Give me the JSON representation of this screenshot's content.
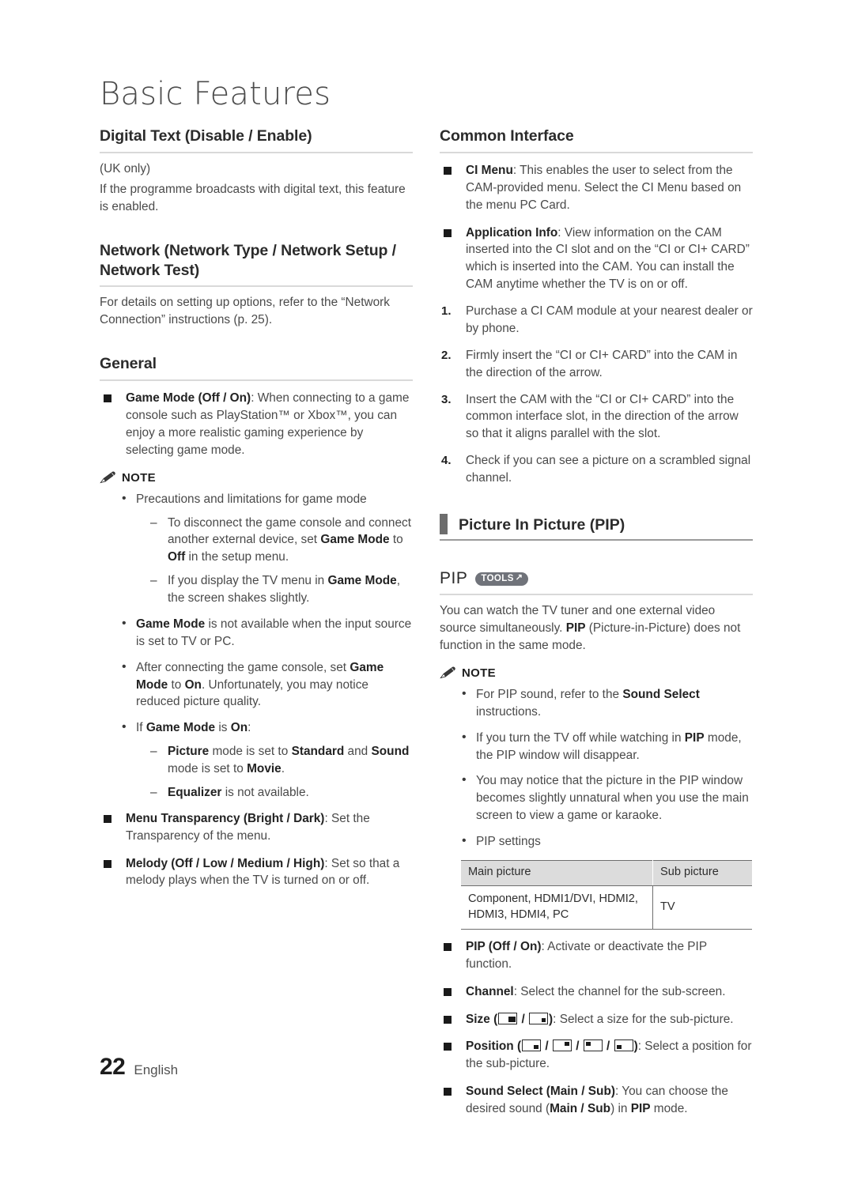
{
  "chapter": {
    "title": "Basic Features"
  },
  "footer": {
    "page_number": "22",
    "language": "English"
  },
  "left_column": {
    "digital_text": {
      "heading": "Digital Text (Disable / Enable)",
      "uk_only": "(UK only)",
      "body": "If the programme broadcasts with digital text, this feature is enabled."
    },
    "network": {
      "heading": "Network (Network Type / Network Setup / Network Test)",
      "body": "For details on setting up options, refer to the “Network Connection” instructions (p. 25)."
    },
    "general": {
      "heading": "General",
      "game_mode": {
        "term": "Game Mode (Off / On)",
        "text": ": When connecting to a game console such as PlayStation™ or Xbox™, you can enjoy a more realistic gaming experience by selecting game mode."
      },
      "note": {
        "label": "NOTE",
        "icon": "pencil-icon",
        "items": [
          {
            "text": "Precautions and limitations for game mode",
            "subitems": [
              "To disconnect the game console and connect another external device, set Game Mode to Off in the setup menu.",
              "If you display the TV menu in Game Mode, the screen shakes slightly."
            ]
          },
          {
            "text": "Game Mode is not available when the input source is set to TV or PC."
          },
          {
            "text": "After connecting the game console, set Game Mode to On. Unfortunately, you may notice reduced picture quality."
          },
          {
            "text": "If Game Mode is On:",
            "subitems": [
              "Picture mode is set to Standard and Sound mode is set to Movie.",
              "Equalizer is not available."
            ]
          }
        ]
      },
      "menu_transparency": {
        "term": "Menu Transparency (Bright / Dark)",
        "text": ": Set the Transparency of the menu."
      },
      "melody": {
        "term": "Melody (Off / Low / Medium / High)",
        "text": ": Set so that a melody plays when the TV is turned on or off."
      }
    }
  },
  "right_column": {
    "common_interface": {
      "heading": "Common Interface",
      "bullets": [
        {
          "term": "CI Menu",
          "text": ": This enables the user to select from the CAM-provided menu. Select the CI Menu based on the menu PC Card."
        },
        {
          "term": "Application Info",
          "text": ": View information on the CAM inserted into the CI slot and on the “CI or CI+ CARD” which is inserted into the CAM. You can install the CAM anytime whether the TV is on or off."
        }
      ],
      "steps": [
        {
          "num": "1.",
          "text": "Purchase a CI CAM module at your nearest dealer or by phone."
        },
        {
          "num": "2.",
          "text": "Firmly insert the “CI or CI+ CARD” into the CAM in the direction of the arrow."
        },
        {
          "num": "3.",
          "text": "Insert the CAM with the “CI or CI+ CARD” into the common interface slot, in the direction of the arrow so that it aligns parallel with the slot."
        },
        {
          "num": "4.",
          "text": "Check if you can see a picture on a scrambled signal channel."
        }
      ]
    },
    "pip_section": {
      "bar_heading": "Picture In Picture (PIP)",
      "pip_heading": "PIP",
      "tools_badge": {
        "label": "TOOLS",
        "icon": "tools-arrow-icon",
        "glyph": "↗"
      },
      "intro": "You can watch the TV tuner and one external video source simultaneously. PIP (Picture-in-Picture) does not function in the same mode.",
      "note": {
        "label": "NOTE",
        "icon": "pencil-icon",
        "items": [
          "For PIP sound, refer to the Sound Select instructions.",
          "If you turn the TV off while watching in PIP mode, the PIP window will disappear.",
          "You may notice that the picture in the PIP window becomes slightly unnatural when you use the main screen to view a game or karaoke.",
          "PIP settings"
        ]
      },
      "table": {
        "headers": [
          "Main picture",
          "Sub picture"
        ],
        "rows": [
          [
            "Component, HDMI1/DVI, HDMI2, HDMI3, HDMI4, PC",
            "TV"
          ]
        ]
      },
      "bullets": [
        {
          "term": "PIP (Off / On)",
          "text": ": Activate or deactivate the PIP function."
        },
        {
          "term": "Channel",
          "text": ": Select the channel for the sub-screen."
        },
        {
          "term": "Size",
          "text": ": Select a size for the sub-picture.",
          "icons": [
            "size-large-icon",
            "size-small-icon"
          ]
        },
        {
          "term": "Position",
          "text": ": Select a position for the sub-picture.",
          "icons": [
            "position-bottom-right-icon",
            "position-top-right-icon",
            "position-top-left-icon",
            "position-bottom-left-icon"
          ]
        },
        {
          "term": "Sound Select (Main / Sub)",
          "text": ": You can choose the desired sound (Main / Sub) in PIP mode."
        }
      ]
    }
  },
  "colors": {
    "heading_rule": "#d9d9d9",
    "bar": "#6d6d6d",
    "badge": "#70737a",
    "table_header": "#dcdcdc"
  }
}
